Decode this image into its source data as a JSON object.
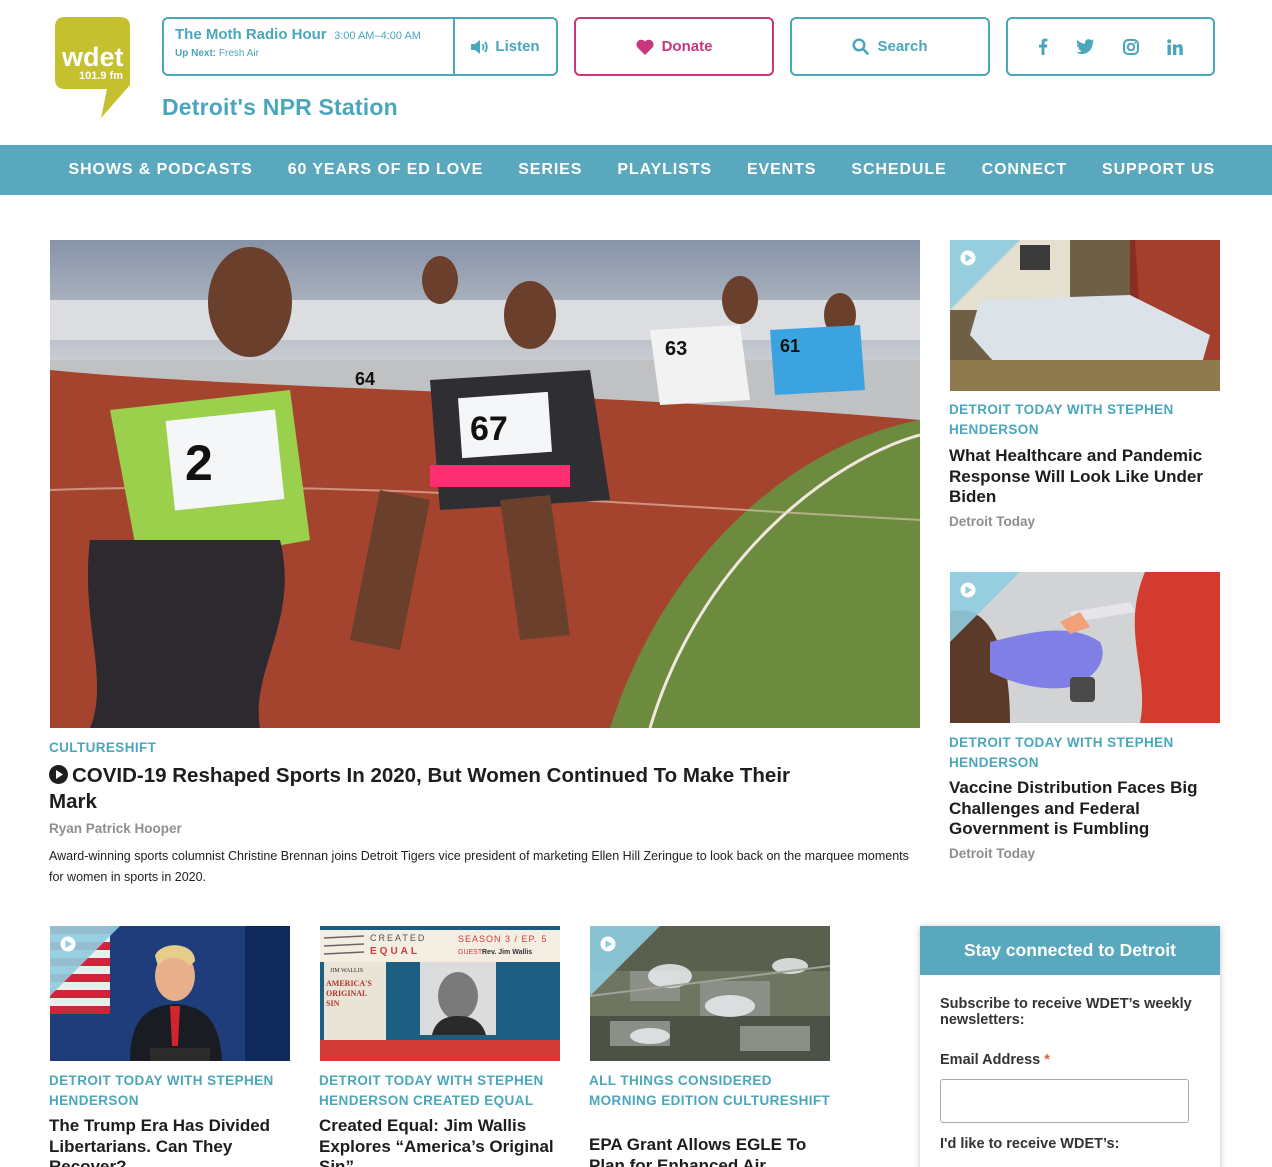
{
  "brand": {
    "logo_text": "wdet",
    "logo_freq": "101.9 fm",
    "tagline": "Detroit's NPR Station",
    "colors": {
      "teal": "#4aa6bb",
      "nav": "#5aa8bd",
      "donate": "#c8367b",
      "logo": "#c5c12e"
    }
  },
  "player": {
    "show": "The Moth Radio Hour",
    "time": "3:00 AM–4:00 AM",
    "up_next_label": "Up Next:",
    "up_next": "Fresh Air",
    "listen_label": "Listen",
    "listen_icon": "speaker-icon"
  },
  "header_actions": {
    "donate_label": "Donate",
    "donate_icon": "heart-icon",
    "search_label": "Search",
    "search_icon": "search-icon",
    "social": [
      "facebook-icon",
      "twitter-icon",
      "instagram-icon",
      "linkedin-icon"
    ]
  },
  "nav": [
    {
      "label": "SHOWS & PODCASTS"
    },
    {
      "label": "60 YEARS OF ED LOVE"
    },
    {
      "label": "SERIES"
    },
    {
      "label": "PLAYLISTS"
    },
    {
      "label": "EVENTS"
    },
    {
      "label": "SCHEDULE"
    },
    {
      "label": "CONNECT"
    },
    {
      "label": "SUPPORT US"
    }
  ],
  "feature": {
    "image": "Women sprinters racing on a red track",
    "category": "CULTURESHIFT",
    "title": "COVID-19 Reshaped Sports In 2020, But Women Continued To Make Their Mark",
    "byline": "Ryan Patrick Hooper",
    "summary": "Award-winning sports columnist Christine Brennan joins Detroit Tigers vice president of marketing Ellen Hill Zeringue to look back on the marquee moments for women in sports in 2020."
  },
  "side_stories": [
    {
      "image": "Empty hospital bed",
      "category": "DETROIT TODAY WITH STEPHEN HENDERSON",
      "title": "What Healthcare and Pandemic Response Will Look Like Under Biden",
      "byline": "Detroit Today"
    },
    {
      "image": "Gloved hand giving a vaccine injection",
      "category": "DETROIT TODAY WITH STEPHEN HENDERSON",
      "title": "Vaccine Distribution Faces Big Challenges and Federal Government is Fumbling",
      "byline": "Detroit Today"
    }
  ],
  "grid_stories": [
    {
      "image": "Speaker at a podium with flags",
      "category": "DETROIT TODAY WITH STEPHEN HENDERSON",
      "title": "The Trump Era Has Divided Libertarians. Can They Recover?"
    },
    {
      "image": "Created Equal podcast artwork",
      "art": {
        "brand_line1": "CREATED",
        "brand_line2": "EQUAL",
        "season": "SEASON 3 / EP. 5",
        "guest_label": "GUEST:",
        "guest": "Rev. Jim Wallis",
        "book_author": "JIM WALLIS",
        "book_title1": "AMERICA'S",
        "book_title2": "ORIGINAL",
        "book_title3": "SIN"
      },
      "category": "DETROIT TODAY WITH STEPHEN HENDERSON CREATED EQUAL",
      "title": "Created Equal: Jim Wallis Explores “America’s Original Sin”"
    },
    {
      "image": "Aerial view of an industrial plant",
      "category": "ALL THINGS CONSIDERED MORNING EDITION CULTURESHIFT",
      "title": "EPA Grant Allows EGLE To Plan for Enhanced Air"
    }
  ],
  "newsletter": {
    "heading": "Stay connected to Detroit",
    "subtitle": "Subscribe to receive WDET’s weekly newsletters:",
    "email_label": "Email Address",
    "required_mark": "*",
    "email_value": "",
    "receive_label": "I'd like to receive WDET’s:"
  }
}
